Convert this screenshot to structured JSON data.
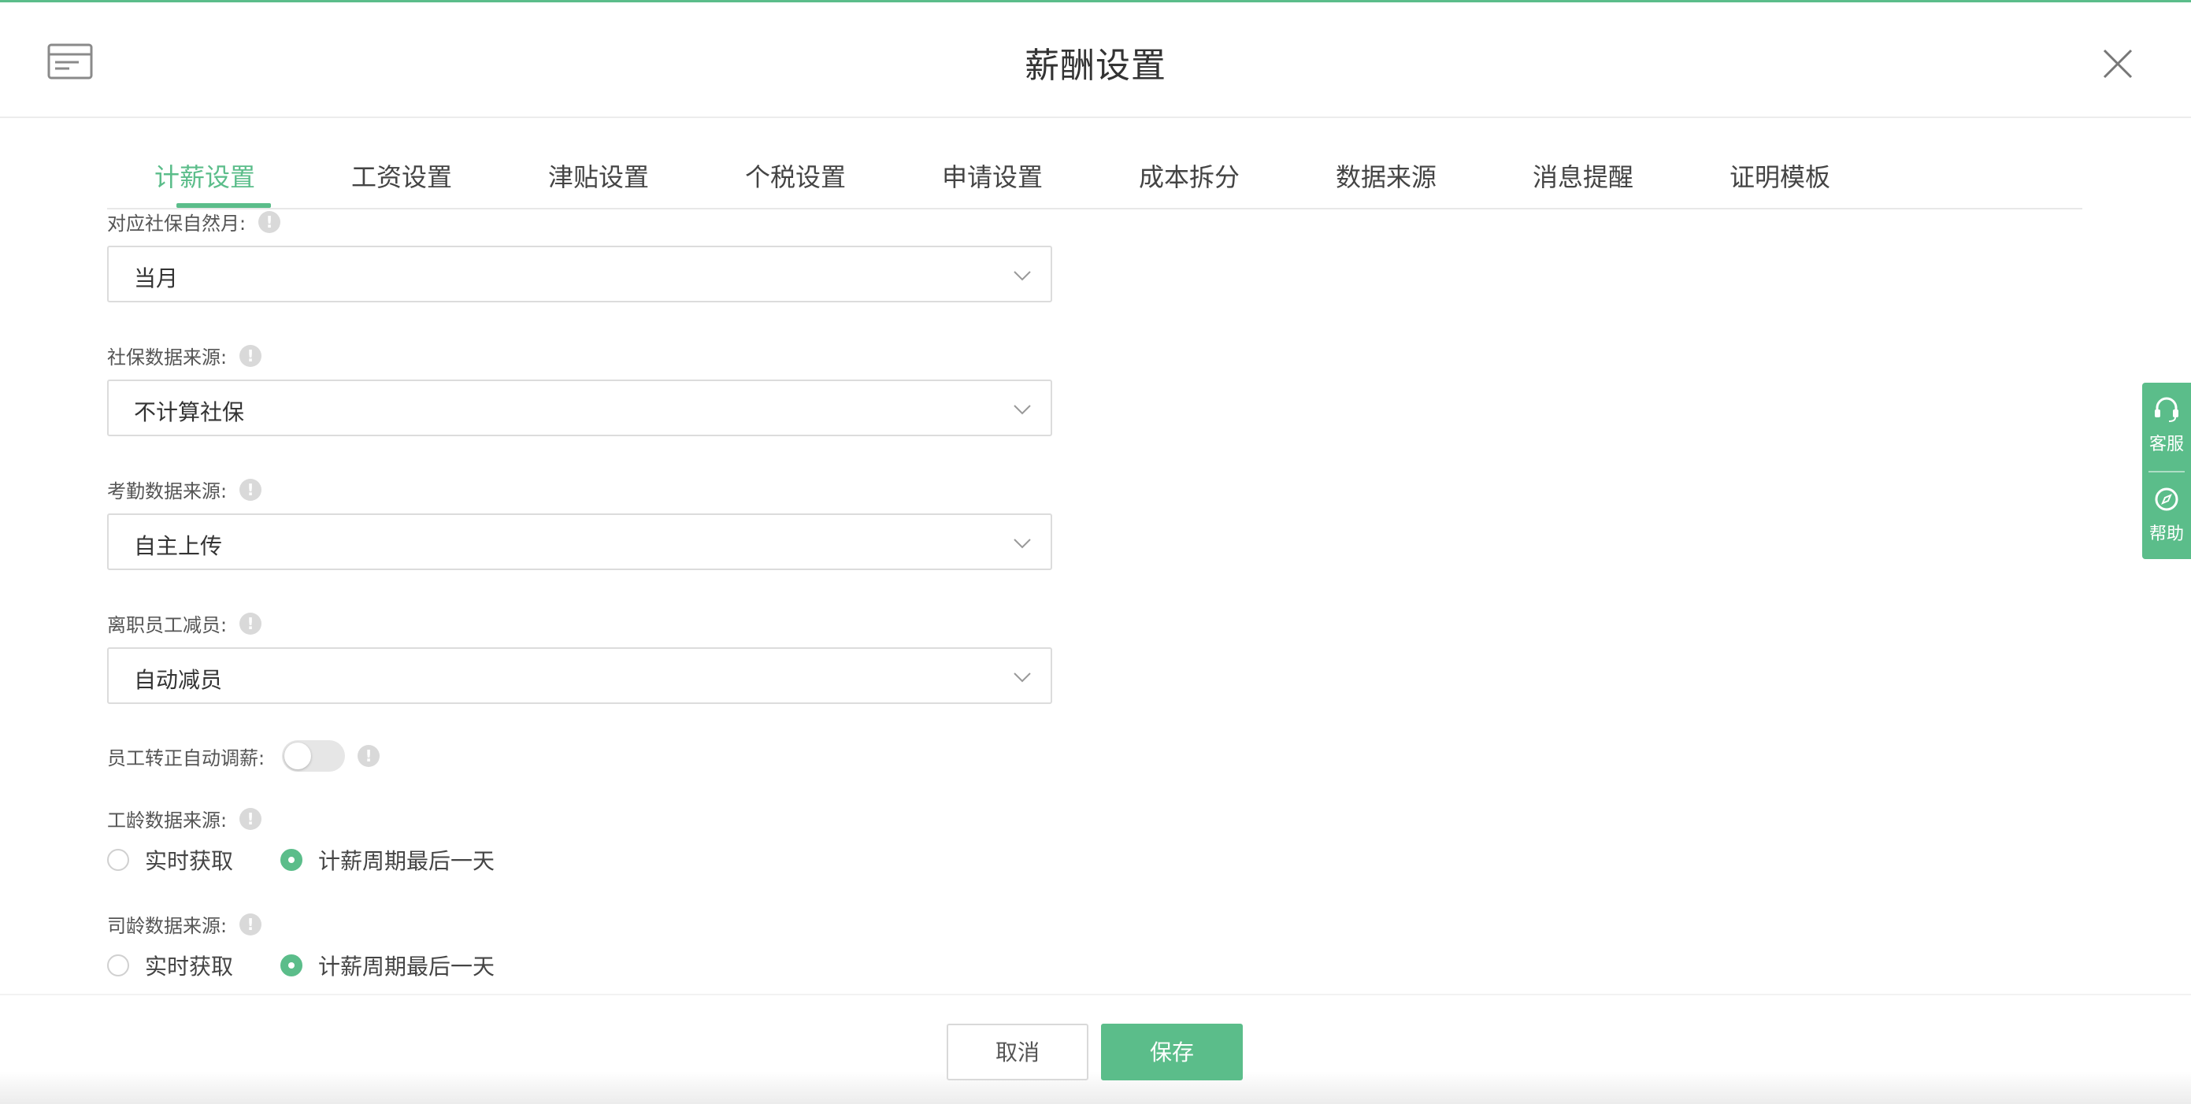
{
  "header": {
    "title": "薪酬设置"
  },
  "tabs": [
    {
      "label": "计薪设置",
      "active": true
    },
    {
      "label": "工资设置"
    },
    {
      "label": "津贴设置"
    },
    {
      "label": "个税设置"
    },
    {
      "label": "申请设置"
    },
    {
      "label": "成本拆分"
    },
    {
      "label": "数据来源"
    },
    {
      "label": "消息提醒"
    },
    {
      "label": "证明模板"
    }
  ],
  "form": {
    "social_month": {
      "label": "对应社保自然月:",
      "value": "当月"
    },
    "social_source": {
      "label": "社保数据来源:",
      "value": "不计算社保"
    },
    "attendance_source": {
      "label": "考勤数据来源:",
      "value": "自主上传"
    },
    "resign_reduce": {
      "label": "离职员工减员:",
      "value": "自动减员"
    },
    "auto_adjust": {
      "label": "员工转正自动调薪:",
      "enabled": false
    },
    "work_age_source": {
      "label": "工龄数据来源:",
      "options": [
        "实时获取",
        "计薪周期最后一天"
      ],
      "selected": "计薪周期最后一天"
    },
    "company_age_source": {
      "label": "司龄数据来源:",
      "options": [
        "实时获取",
        "计薪周期最后一天"
      ],
      "selected": "计薪周期最后一天"
    },
    "info_glyph": "!"
  },
  "footer": {
    "cancel_label": "取消",
    "save_label": "保存"
  },
  "side_widget": {
    "service_label": "客服",
    "help_label": "帮助"
  },
  "colors": {
    "accent": "#5bbd8a",
    "text": "#333333",
    "border": "#dcdcdc"
  },
  "icons": [
    "card-icon",
    "close-icon",
    "info-icon",
    "chevron-down-icon",
    "headset-icon",
    "compass-icon"
  ]
}
